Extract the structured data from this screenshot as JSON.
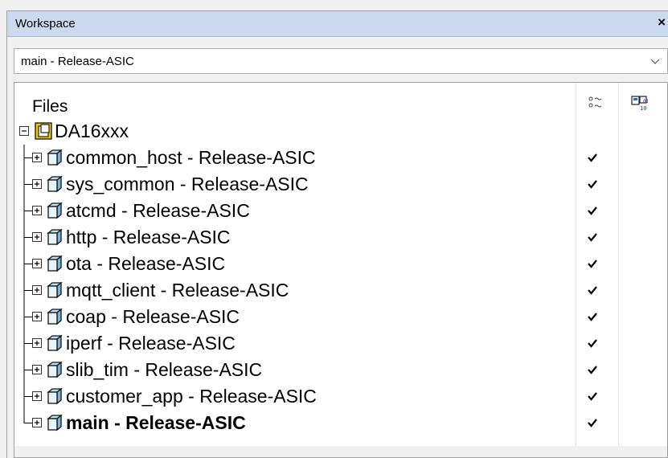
{
  "panel": {
    "title": "Workspace",
    "close_glyph": "×",
    "close_icon": "close-icon"
  },
  "configuration": {
    "selected": "main - Release-ASIC",
    "dropdown_icon": "chevron-down-icon"
  },
  "tree": {
    "header": {
      "files_label": "Files",
      "column_icons": [
        "choose-configuration-icon",
        "output-settings-icon"
      ]
    },
    "root": {
      "label": "DA16xxx",
      "expanded": true,
      "icon": "workspace-folder-icon"
    },
    "projects": [
      {
        "label": "common_host - Release-ASIC",
        "active": false,
        "checked": true
      },
      {
        "label": "sys_common - Release-ASIC",
        "active": false,
        "checked": true
      },
      {
        "label": "atcmd - Release-ASIC",
        "active": false,
        "checked": true
      },
      {
        "label": "http - Release-ASIC",
        "active": false,
        "checked": true
      },
      {
        "label": "ota - Release-ASIC",
        "active": false,
        "checked": true
      },
      {
        "label": "mqtt_client - Release-ASIC",
        "active": false,
        "checked": true
      },
      {
        "label": "coap - Release-ASIC",
        "active": false,
        "checked": true
      },
      {
        "label": "iperf - Release-ASIC",
        "active": false,
        "checked": true
      },
      {
        "label": "slib_tim - Release-ASIC",
        "active": false,
        "checked": true
      },
      {
        "label": "customer_app - Release-ASIC",
        "active": false,
        "checked": true
      },
      {
        "label": "main - Release-ASIC",
        "active": true,
        "checked": true
      }
    ]
  }
}
